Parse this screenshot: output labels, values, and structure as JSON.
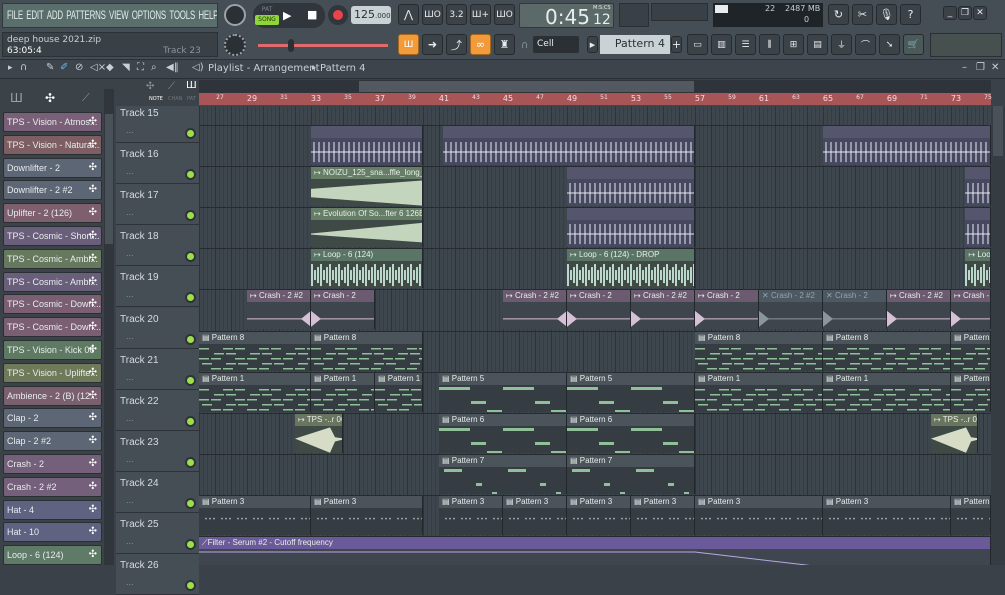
{
  "menu": [
    "FILE",
    "EDIT",
    "ADD",
    "PATTERNS",
    "VIEW",
    "OPTIONS",
    "TOOLS",
    "HELP"
  ],
  "project": {
    "name": "deep house 2021.zip",
    "position": "63:05:4",
    "hint": "Track 23"
  },
  "transport": {
    "pat": "PAT",
    "song": "SONG",
    "mode": "song",
    "tempo": "125",
    "tempo_dec": ".000",
    "time": "0:45",
    "time_cs": "12",
    "time_format": "M:S:CS"
  },
  "monitor": {
    "cpu": "22",
    "memory": "2487 MB",
    "polyphony": "0"
  },
  "toolbar": {
    "snap": "Cell",
    "pattern": "Pattern 4"
  },
  "playlist": {
    "title": "Playlist - Arrangement",
    "pattern": "Pattern 4",
    "tabs": [
      "NOTE",
      "CHAN",
      "PAT"
    ]
  },
  "colors": {
    "accent": "#f29b3a",
    "ruler": "#a85558",
    "led": "#9be04a"
  },
  "browser": [
    {
      "label": "TPS - Vision - Atmos...",
      "color": "#7a5f78"
    },
    {
      "label": "TPS - Vision - Natura...",
      "color": "#7d5f63"
    },
    {
      "label": "Downlifter - 2",
      "color": "#5c6675"
    },
    {
      "label": "Downlifter - 2 #2",
      "color": "#5c6675"
    },
    {
      "label": "Uplifter - 2 (126)",
      "color": "#7d5f6e"
    },
    {
      "label": "TPS - Cosmic - Short...",
      "color": "#6a5f7a"
    },
    {
      "label": "TPS - Cosmic - Ambi...",
      "color": "#66795e"
    },
    {
      "label": "TPS - Cosmic - Ambi...",
      "color": "#6a5f7a"
    },
    {
      "label": "TPS - Cosmic - Down...",
      "color": "#7a5f72"
    },
    {
      "label": "TPS - Cosmic - Down...",
      "color": "#7a5f72"
    },
    {
      "label": "TPS - Vision - Kick 06",
      "color": "#5f7a62"
    },
    {
      "label": "TPS - Vision - Uplifte...",
      "color": "#6e7a5a"
    },
    {
      "label": "Ambience - 2  (B) (12...",
      "color": "#7a5f6e"
    },
    {
      "label": "Clap - 2",
      "color": "#5c6675"
    },
    {
      "label": "Clap - 2 #2",
      "color": "#5c6675"
    },
    {
      "label": "Crash - 2",
      "color": "#74607a"
    },
    {
      "label": "Crash - 2 #2",
      "color": "#74607a"
    },
    {
      "label": "Hat - 4",
      "color": "#5f6280"
    },
    {
      "label": "Hat - 10",
      "color": "#5f6280"
    },
    {
      "label": "Loop - 6 (124)",
      "color": "#5f7a66"
    }
  ],
  "tracks": [
    "Track 15",
    "Track 16",
    "Track 17",
    "Track 18",
    "Track 19",
    "Track 20",
    "Track 21",
    "Track 22",
    "Track 23",
    "Track 24",
    "Track 25",
    "Track 26"
  ],
  "ruler": {
    "first_bar": 26,
    "labels": [
      27,
      29,
      31,
      33,
      35,
      37,
      39,
      41,
      43,
      45,
      47,
      49,
      51,
      53,
      55,
      57,
      59,
      61,
      63,
      65,
      67,
      69,
      71,
      73,
      75
    ]
  },
  "clips": [
    {
      "track": 0,
      "start": 33,
      "end": 40,
      "label": "",
      "kind": "spikes"
    },
    {
      "track": 0,
      "start": 41.25,
      "end": 57,
      "label": "",
      "kind": "spikes"
    },
    {
      "track": 0,
      "start": 65,
      "end": 75.5,
      "label": "",
      "kind": "spikes"
    },
    {
      "track": 1,
      "start": 33,
      "end": 40,
      "label": "NOIZU_125_sna...ffle_long_05",
      "kind": "ramp-down"
    },
    {
      "track": 1,
      "start": 49,
      "end": 57,
      "label": "",
      "kind": "spikes"
    },
    {
      "track": 1,
      "start": 73.9,
      "end": 75.5,
      "label": "",
      "kind": "spikes"
    },
    {
      "track": 2,
      "start": 33,
      "end": 40,
      "label": "Evolution Of So...fter 6 126BPM",
      "kind": "ramp-up"
    },
    {
      "track": 2,
      "start": 49,
      "end": 57,
      "label": "",
      "kind": "spikes"
    },
    {
      "track": 2,
      "start": 73.9,
      "end": 75.5,
      "label": "",
      "kind": "spikes"
    },
    {
      "track": 3,
      "start": 33,
      "end": 40,
      "label": "Loop - 6 (124)",
      "kind": "loop"
    },
    {
      "track": 3,
      "start": 49,
      "end": 57,
      "label": "Loop - 6 (124) - DROP",
      "kind": "loop"
    },
    {
      "track": 3,
      "start": 73.9,
      "end": 75.5,
      "label": "Loop..24)",
      "kind": "loop"
    },
    {
      "track": 4,
      "start": 29,
      "end": 33,
      "label": "Crash - 2 #2",
      "kind": "crash"
    },
    {
      "track": 4,
      "start": 33,
      "end": 37,
      "label": "Crash - 2",
      "kind": "crash"
    },
    {
      "track": 4,
      "start": 45,
      "end": 49,
      "label": "Crash - 2 #2",
      "kind": "crash"
    },
    {
      "track": 4,
      "start": 49,
      "end": 53,
      "label": "Crash - 2",
      "kind": "crash"
    },
    {
      "track": 4,
      "start": 53,
      "end": 57,
      "label": "Crash - 2 #2",
      "kind": "crash"
    },
    {
      "track": 4,
      "start": 57,
      "end": 61,
      "label": "Crash - 2",
      "kind": "crash"
    },
    {
      "track": 4,
      "start": 61,
      "end": 65,
      "label": "Crash - 2 #2",
      "kind": "crash-muted"
    },
    {
      "track": 4,
      "start": 65,
      "end": 69,
      "label": "Crash - 2",
      "kind": "crash-muted"
    },
    {
      "track": 4,
      "start": 69,
      "end": 73,
      "label": "Crash - 2 #2",
      "kind": "crash"
    },
    {
      "track": 4,
      "start": 73,
      "end": 75.5,
      "label": "Crash - 2",
      "kind": "crash"
    },
    {
      "track": 5,
      "start": 26,
      "end": 33,
      "label": "Pattern 8",
      "kind": "notes-dense"
    },
    {
      "track": 5,
      "start": 33,
      "end": 40,
      "label": "Pattern 8",
      "kind": "notes-dense"
    },
    {
      "track": 5,
      "start": 57,
      "end": 65,
      "label": "Pattern 8",
      "kind": "notes-dense"
    },
    {
      "track": 5,
      "start": 65,
      "end": 73,
      "label": "Pattern 8",
      "kind": "notes-dense"
    },
    {
      "track": 5,
      "start": 73,
      "end": 75.5,
      "label": "Pattern 8",
      "kind": "notes-dense"
    },
    {
      "track": 6,
      "start": 26,
      "end": 33,
      "label": "Pattern 1",
      "kind": "notes-dense"
    },
    {
      "track": 6,
      "start": 33,
      "end": 37,
      "label": "Pattern 1",
      "kind": "notes-dense"
    },
    {
      "track": 6,
      "start": 37,
      "end": 40,
      "label": "Pattern 1",
      "kind": "notes-dense"
    },
    {
      "track": 6,
      "start": 41,
      "end": 49,
      "label": "Pattern 5",
      "kind": "notes-sparse"
    },
    {
      "track": 6,
      "start": 49,
      "end": 57,
      "label": "Pattern 5",
      "kind": "notes-sparse"
    },
    {
      "track": 6,
      "start": 57,
      "end": 65,
      "label": "Pattern 1",
      "kind": "notes-dense"
    },
    {
      "track": 6,
      "start": 65,
      "end": 73,
      "label": "Pattern 1",
      "kind": "notes-dense"
    },
    {
      "track": 6,
      "start": 73,
      "end": 75.5,
      "label": "Pattern 1",
      "kind": "notes-dense"
    },
    {
      "track": 7,
      "start": 32,
      "end": 35,
      "label": "TPS -..r 06",
      "kind": "kick"
    },
    {
      "track": 7,
      "start": 41,
      "end": 49,
      "label": "Pattern 6",
      "kind": "notes-sparse"
    },
    {
      "track": 7,
      "start": 49,
      "end": 57,
      "label": "Pattern 6",
      "kind": "notes-sparse"
    },
    {
      "track": 7,
      "start": 71.75,
      "end": 74.7,
      "label": "TPS -..r 06",
      "kind": "kick"
    },
    {
      "track": 8,
      "start": 41,
      "end": 49,
      "label": "Pattern 7",
      "kind": "notes-perc"
    },
    {
      "track": 8,
      "start": 49,
      "end": 57,
      "label": "Pattern 7",
      "kind": "notes-perc"
    },
    {
      "track": 9,
      "start": 26,
      "end": 33,
      "label": "Pattern 3",
      "kind": "notes-hat"
    },
    {
      "track": 9,
      "start": 33,
      "end": 40,
      "label": "Pattern 3",
      "kind": "notes-hat"
    },
    {
      "track": 9,
      "start": 41,
      "end": 45,
      "label": "Pattern 3",
      "kind": "notes-hat"
    },
    {
      "track": 9,
      "start": 45,
      "end": 49,
      "label": "Pattern 3",
      "kind": "notes-hat"
    },
    {
      "track": 9,
      "start": 49,
      "end": 53,
      "label": "Pattern 3",
      "kind": "notes-hat"
    },
    {
      "track": 9,
      "start": 53,
      "end": 57,
      "label": "Pattern 3",
      "kind": "notes-hat"
    },
    {
      "track": 9,
      "start": 57,
      "end": 65,
      "label": "Pattern 3",
      "kind": "notes-hat"
    },
    {
      "track": 9,
      "start": 65,
      "end": 73,
      "label": "Pattern 3",
      "kind": "notes-hat"
    },
    {
      "track": 9,
      "start": 73,
      "end": 75.5,
      "label": "Pattern 3",
      "kind": "notes-hat"
    },
    {
      "track": 10,
      "start": 26,
      "end": 75.5,
      "label": "Filter - Serum #2 - Cutoff frequency",
      "kind": "automation"
    }
  ]
}
